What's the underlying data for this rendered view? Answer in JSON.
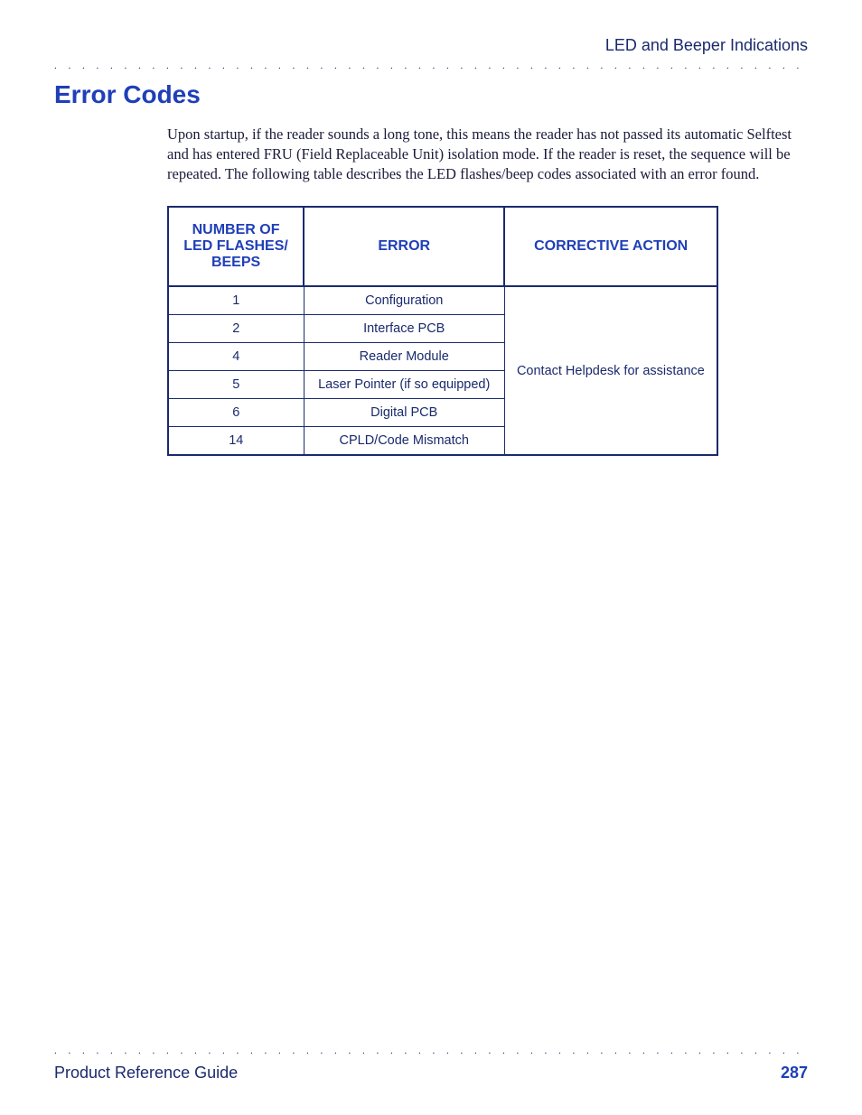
{
  "header": {
    "section_title": "LED and Beeper Indications"
  },
  "heading": "Error Codes",
  "body_text": "Upon startup, if the reader sounds a long tone, this means the reader has not passed its automatic Selftest and has entered FRU (Field Replaceable Unit) isolation mode. If the reader is reset, the sequence will be repeated. The following table describes the LED flashes/beep codes associated with an error found.",
  "table": {
    "headers": {
      "count": "NUMBER OF LED FLASHES/ BEEPS",
      "error": "ERROR",
      "action": "CORRECTIVE ACTION"
    },
    "rows": [
      {
        "count": "1",
        "error": "Configuration"
      },
      {
        "count": "2",
        "error": "Interface PCB"
      },
      {
        "count": "4",
        "error": "Reader Module"
      },
      {
        "count": "5",
        "error": "Laser Pointer (if so equipped)"
      },
      {
        "count": "6",
        "error": "Digital PCB"
      },
      {
        "count": "14",
        "error": "CPLD/Code Mismatch"
      }
    ],
    "corrective_action": "Contact Helpdesk for assistance"
  },
  "footer": {
    "title": "Product Reference Guide",
    "page": "287"
  }
}
